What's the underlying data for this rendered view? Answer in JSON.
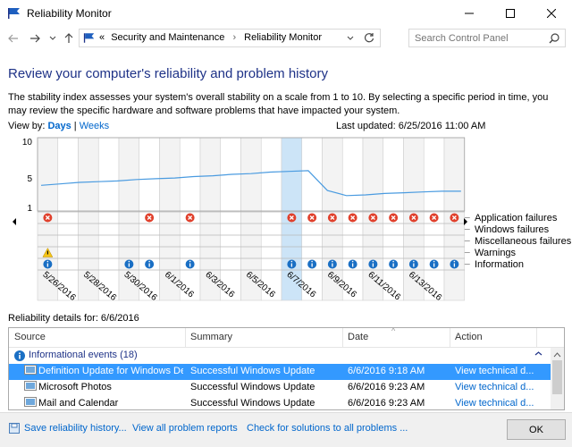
{
  "window": {
    "title": "Reliability Monitor",
    "controls": [
      "minimize",
      "maximize",
      "close"
    ]
  },
  "address_bar": {
    "overflow": "«",
    "breadcrumbs": [
      "Security and Maintenance",
      "Reliability Monitor"
    ],
    "search_placeholder": "Search Control Panel"
  },
  "page": {
    "title": "Review your computer's reliability and problem history",
    "description": "The stability index assesses your system's overall stability on a scale from 1 to 10. By selecting a specific period in time, you may review the specific hardware and software problems that have impacted your system.",
    "view_by_label": "View by:",
    "view_days": "Days",
    "view_separator": "|",
    "view_weeks": "Weeks",
    "last_updated": "Last updated: 6/25/2016 11:00 AM"
  },
  "chart_data": {
    "type": "line",
    "y_ticks": [
      "10",
      "5",
      "1"
    ],
    "ylim": [
      1,
      10
    ],
    "x_labels": [
      "5/26/2016",
      "5/28/2016",
      "5/30/2016",
      "6/1/2016",
      "6/3/2016",
      "6/5/2016",
      "6/7/2016",
      "6/9/2016",
      "6/11/2016",
      "6/13/2016"
    ],
    "selected_day_index": 12,
    "stability_index": [
      4.0,
      4.2,
      4.4,
      4.5,
      4.6,
      4.8,
      4.9,
      5.0,
      5.2,
      5.3,
      5.5,
      5.6,
      5.8,
      5.9,
      6.0,
      3.3,
      2.6,
      2.7,
      2.9,
      3.0,
      3.1,
      3.2,
      3.2
    ],
    "rows": [
      "Application failures",
      "Windows failures",
      "Miscellaneous failures",
      "Warnings",
      "Information"
    ],
    "app_failure_days": [
      0,
      5,
      7,
      12,
      13,
      14,
      15,
      16,
      17,
      18,
      19,
      20
    ],
    "warning_days": [
      0
    ],
    "information_days": [
      0,
      4,
      5,
      7,
      12,
      13,
      14,
      15,
      16,
      17,
      18,
      19,
      20
    ]
  },
  "details": {
    "label": "Reliability details for: 6/6/2016",
    "columns": [
      "Source",
      "Summary",
      "Date",
      "Action"
    ],
    "group": "Informational events (18)",
    "rows": [
      {
        "source": "Definition Update for Windows De...",
        "summary": "Successful Windows Update",
        "date": "6/6/2016 9:18 AM",
        "action": "View  technical d...",
        "selected": true
      },
      {
        "source": "Microsoft Photos",
        "summary": "Successful Windows Update",
        "date": "6/6/2016 9:23 AM",
        "action": "View  technical d...",
        "selected": false
      },
      {
        "source": "Mail and Calendar",
        "summary": "Successful Windows Update",
        "date": "6/6/2016 9:23 AM",
        "action": "View  technical d...",
        "selected": false
      }
    ]
  },
  "footer": {
    "save_history": "Save reliability history...",
    "view_all": "View all problem reports",
    "check_solutions": "Check for solutions to all problems ...",
    "ok": "OK"
  },
  "colors": {
    "accent": "#0066cc",
    "title": "#1e3287",
    "selected_row": "#3399ff",
    "error_red": "#e0402c",
    "info_blue": "#1a6fc4",
    "warning_yellow": "#f5c518"
  }
}
